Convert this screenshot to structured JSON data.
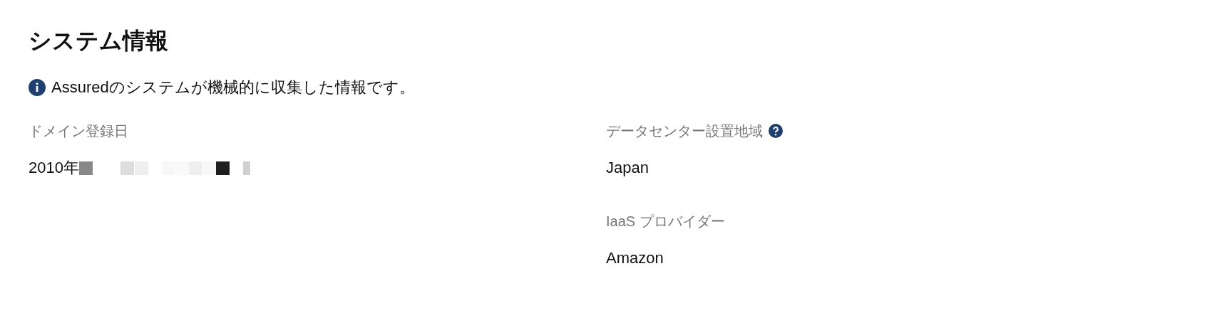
{
  "title": "システム情報",
  "notice": {
    "kind": "info",
    "text": "Assuredのシステムが機械的に収集した情報です。"
  },
  "columns": [
    [
      {
        "label": "ドメイン登録日",
        "value": "2010年",
        "help": false,
        "redacted": true
      }
    ],
    [
      {
        "label": "データセンター設置地域",
        "value": "Japan",
        "help": true,
        "redacted": false
      },
      {
        "label": "IaaS プロバイダー",
        "value": "Amazon",
        "help": false,
        "redacted": false
      }
    ]
  ]
}
